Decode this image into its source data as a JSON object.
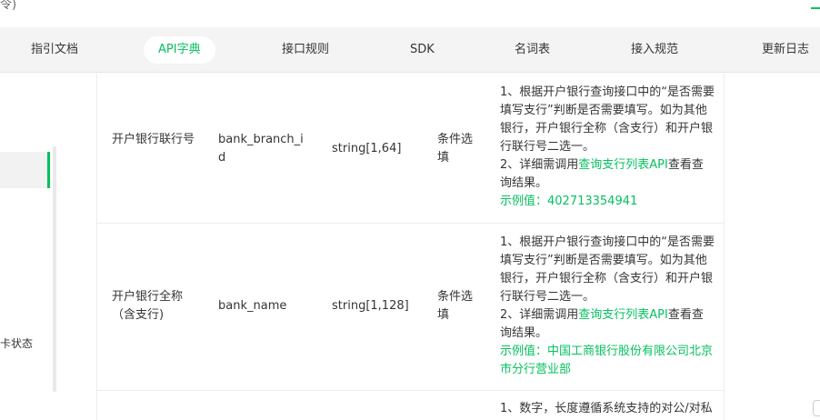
{
  "topbar": {
    "stub": "令)"
  },
  "nav": {
    "items": [
      {
        "label": "指引文档",
        "active": false
      },
      {
        "label": "API字典",
        "active": true
      },
      {
        "label": "接口规则",
        "active": false
      },
      {
        "label": "SDK",
        "active": false
      },
      {
        "label": "名词表",
        "active": false
      },
      {
        "label": "接入规范",
        "active": false
      },
      {
        "label": "更新日志",
        "active": false
      }
    ]
  },
  "sidebar": {
    "partial_item": "卡状态"
  },
  "table": {
    "rows": [
      {
        "name": "开户银行联行号",
        "field": "bank_branch_id",
        "type": "string[1,64]",
        "required": "条件选填",
        "desc_lines": [
          "1、根据开户银行查询接口中的“是否需要填写支行”判断是否需要填写。如为其他银行，开户银行全称（含支行）和开户银行联行号二选一。"
        ],
        "desc_line2_prefix": "2、详细需调用",
        "desc_link": "查询支行列表API",
        "desc_line2_suffix": "查看查询结果。",
        "example": "示例值：402713354941"
      },
      {
        "name": "开户银行全称（含支行)",
        "field": "bank_name",
        "type": "string[1,128]",
        "required": "条件选填",
        "desc_lines": [
          "1、根据开户银行查询接口中的“是否需要填写支行”判断是否需要填写。如为其他银行，开户银行全称（含支行）和开户银行联行号二选一。"
        ],
        "desc_line2_prefix": "2、详细需调用",
        "desc_link": "查询支行列表API",
        "desc_line2_suffix": "查看查询结果。",
        "example": "示例值：中国工商银行股份有限公司北京市分行营业部"
      },
      {
        "desc_partial": "1、数字，长度遵循系统支持的对公/对私"
      }
    ]
  },
  "colors": {
    "accent": "#07c160",
    "nav_bg": "#f4f4f4",
    "text": "#353535"
  }
}
